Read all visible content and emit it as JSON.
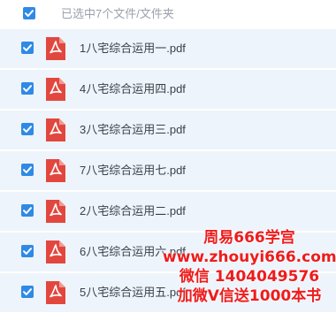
{
  "header": {
    "selected_text": "已选中7个文件/文件夹"
  },
  "files": [
    {
      "name": "1八宅综合运用一.pdf",
      "icon": "pdf-icon",
      "checked": true
    },
    {
      "name": "4八宅综合运用四.pdf",
      "icon": "pdf-icon",
      "checked": true
    },
    {
      "name": "3八宅综合运用三.pdf",
      "icon": "pdf-icon",
      "checked": true
    },
    {
      "name": "7八宅综合运用七.pdf",
      "icon": "pdf-icon",
      "checked": true
    },
    {
      "name": "2八宅综合运用二.pdf",
      "icon": "pdf-icon",
      "checked": true
    },
    {
      "name": "6八宅综合运用六.pdf",
      "icon": "pdf-icon",
      "checked": true
    },
    {
      "name": "5八宅综合运用五.pdf",
      "icon": "pdf-icon",
      "checked": true
    }
  ],
  "watermark": {
    "line1": "周易666学宫",
    "line2": "www.zhouyi666.com",
    "line3": "微信 1404049576",
    "line4": "加微V信送1000本书"
  },
  "colors": {
    "checkbox": "#2f8ae5",
    "row_background": "#eef4fb",
    "pdf_icon": "#e2473f",
    "watermark": "#ee1c1c"
  }
}
